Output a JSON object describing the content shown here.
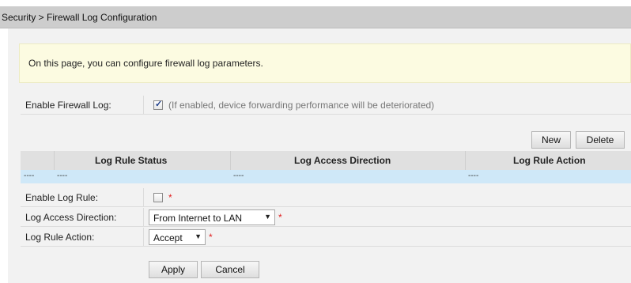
{
  "breadcrumb": "Security > Firewall Log Configuration",
  "info": "On this page, you can configure firewall log parameters.",
  "enable_firewall_log": {
    "label": "Enable Firewall Log:",
    "checked": true,
    "hint": "(If enabled, device forwarding performance will be deteriorated)"
  },
  "buttons": {
    "new": "New",
    "delete": "Delete",
    "apply": "Apply",
    "cancel": "Cancel"
  },
  "table": {
    "headers": [
      "Log Rule Status",
      "Log Access Direction",
      "Log Rule Action"
    ],
    "rows": [
      [
        "----",
        "----",
        "----",
        "----"
      ]
    ]
  },
  "form": {
    "enable_log_rule": {
      "label": "Enable Log Rule:",
      "checked": false
    },
    "log_access_direction": {
      "label": "Log Access Direction:",
      "value": "From Internet to LAN"
    },
    "log_rule_action": {
      "label": "Log Rule Action:",
      "value": "Accept"
    },
    "required_mark": "*"
  },
  "colors": {
    "breadcrumb_bg": "#cdcdcd",
    "info_bg": "#fcfbe1",
    "table_header_bg": "#e0e0e0",
    "table_row_bg": "#cfe8f8",
    "required": "#e02020"
  },
  "icons": {
    "checkbox_checked": "checkbox-checked-icon",
    "dropdown": "chevron-down-icon"
  }
}
